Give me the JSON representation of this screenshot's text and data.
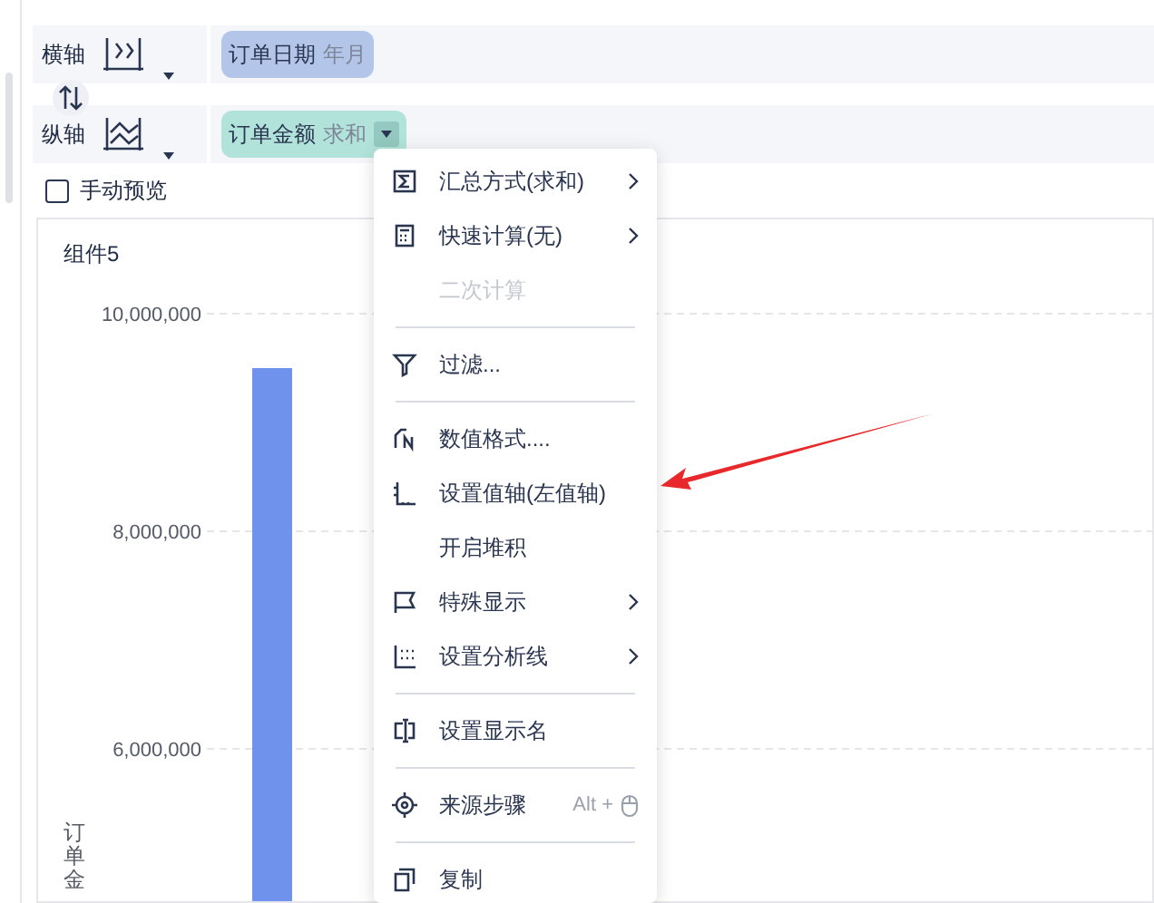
{
  "axes": [
    {
      "label": "横轴",
      "field": {
        "name": "订单日期",
        "detail": "年月",
        "color": "#b3c6ea",
        "has_dropdown": false
      }
    },
    {
      "label": "纵轴",
      "field": {
        "name": "订单金额",
        "detail": "求和",
        "color": "#b2e3da",
        "has_dropdown": true
      }
    }
  ],
  "manual_preview": {
    "label": "手动预览",
    "checked": false
  },
  "widget": {
    "title": "组件5",
    "chart_data": {
      "type": "bar",
      "ylabel": "订单金",
      "values": [
        9500000
      ],
      "grid": true,
      "ylim": [
        0,
        10000000
      ],
      "yticks": [
        {
          "value": 6000000,
          "label": "6,000,000"
        },
        {
          "value": 8000000,
          "label": "8,000,000"
        },
        {
          "value": 10000000,
          "label": "10,000,000"
        }
      ]
    }
  },
  "context_menu": {
    "groups": [
      [
        {
          "label": "汇总方式(求和)",
          "submenu": true,
          "disabled": false
        },
        {
          "label": "快速计算(无)",
          "submenu": true,
          "disabled": false
        },
        {
          "label": "二次计算",
          "submenu": false,
          "disabled": true
        }
      ],
      [
        {
          "label": "过滤...",
          "submenu": false,
          "disabled": false
        }
      ],
      [
        {
          "label": "数值格式....",
          "submenu": false,
          "disabled": false
        },
        {
          "label": "设置值轴(左值轴)",
          "submenu": false,
          "disabled": false
        },
        {
          "label": "开启堆积",
          "submenu": false,
          "disabled": false
        },
        {
          "label": "特殊显示",
          "submenu": true,
          "disabled": false
        },
        {
          "label": "设置分析线",
          "submenu": true,
          "disabled": false
        }
      ],
      [
        {
          "label": "设置显示名",
          "submenu": false,
          "disabled": false
        }
      ],
      [
        {
          "label": "来源步骤",
          "submenu": false,
          "disabled": false,
          "shortcut": "Alt +"
        }
      ],
      [
        {
          "label": "复制",
          "submenu": false,
          "disabled": false
        }
      ]
    ]
  }
}
